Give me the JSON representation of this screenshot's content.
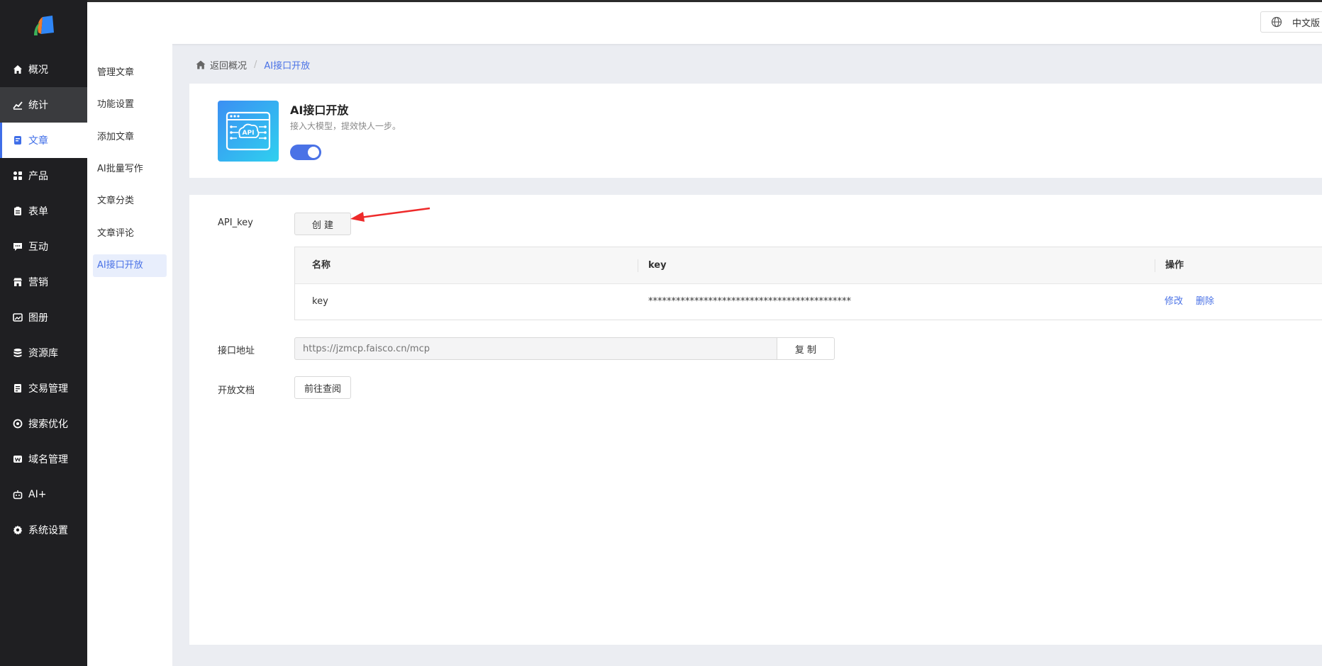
{
  "sidebar": {
    "items": [
      {
        "label": "概况",
        "icon": "home-icon"
      },
      {
        "label": "统计",
        "icon": "chart-icon"
      },
      {
        "label": "文章",
        "icon": "document-icon"
      },
      {
        "label": "产品",
        "icon": "grid-icon"
      },
      {
        "label": "表单",
        "icon": "clipboard-icon"
      },
      {
        "label": "互动",
        "icon": "chat-icon"
      },
      {
        "label": "营销",
        "icon": "store-icon"
      },
      {
        "label": "图册",
        "icon": "image-icon"
      },
      {
        "label": "资源库",
        "icon": "database-icon"
      },
      {
        "label": "交易管理",
        "icon": "order-icon"
      },
      {
        "label": "搜索优化",
        "icon": "search-target-icon"
      },
      {
        "label": "域名管理",
        "icon": "w-icon"
      },
      {
        "label": "AI+",
        "icon": "robot-icon"
      },
      {
        "label": "系统设置",
        "icon": "gear-icon"
      }
    ],
    "active_index": 2,
    "hover_index": 1,
    "accent_color": "#3f6ee8"
  },
  "header": {
    "language_label": "中文版"
  },
  "subnav": {
    "items": [
      "管理文章",
      "功能设置",
      "添加文章",
      "AI批量写作",
      "文章分类",
      "文章评论",
      "AI接口开放"
    ],
    "active_index": 6
  },
  "breadcrumb": {
    "back_label": "返回概况",
    "separator": "/",
    "current": "AI接口开放"
  },
  "feature": {
    "title": "AI接口开放",
    "description": "接入大模型，提效快人一步。",
    "icon_text": "API",
    "enabled": true
  },
  "api_key": {
    "label": "API_key",
    "create_button": "创 建",
    "columns": [
      "名称",
      "key",
      "操作"
    ],
    "rows": [
      {
        "name": "key",
        "key": "********************************************",
        "actions": [
          "修改",
          "删除"
        ]
      }
    ]
  },
  "endpoint": {
    "label": "接口地址",
    "placeholder": "https://jzmcp.faisco.cn/mcp",
    "copy_button": "复 制"
  },
  "docs": {
    "label": "开放文档",
    "button": "前往查阅"
  }
}
